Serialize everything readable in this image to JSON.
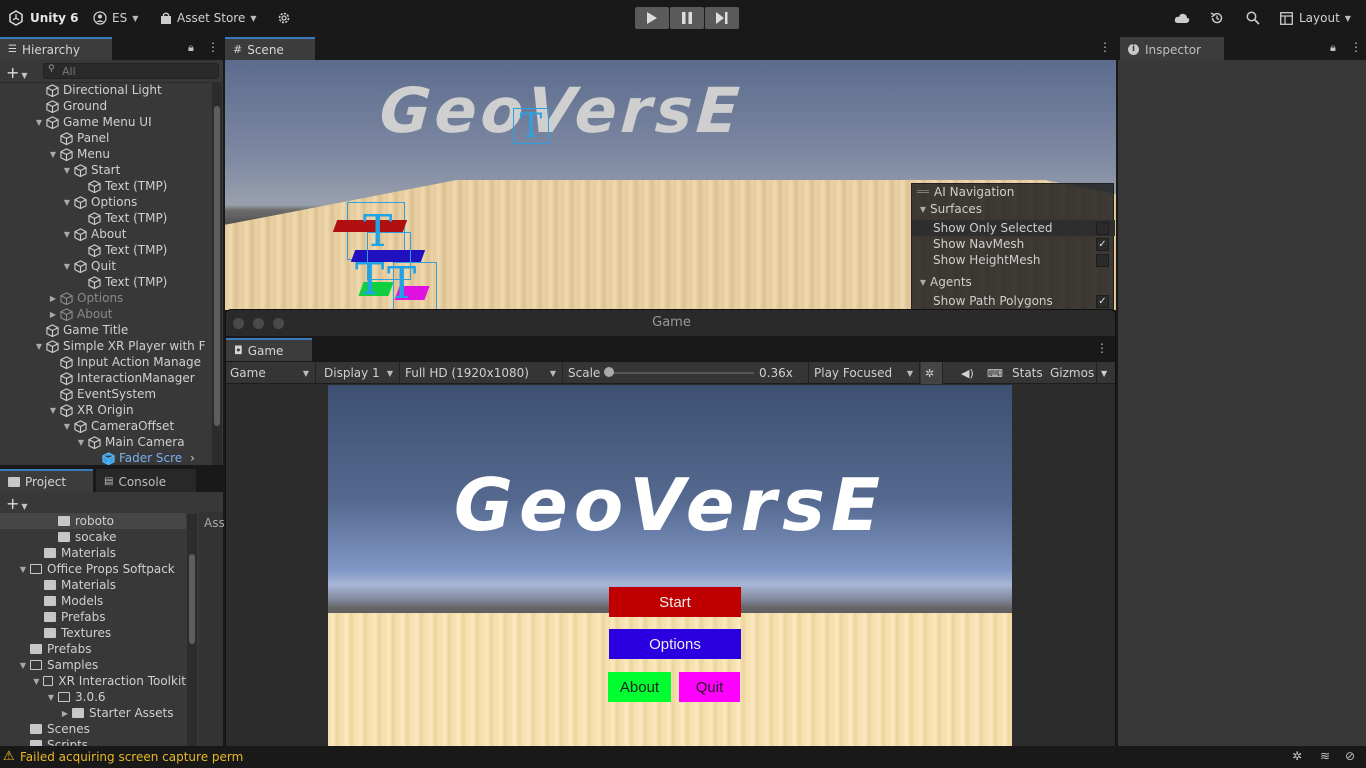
{
  "topbar": {
    "app": "Unity 6",
    "account": "ES",
    "asset_store": "Asset Store",
    "layout": "Layout"
  },
  "hierarchy": {
    "tab": "Hierarchy",
    "search_placeholder": "All",
    "items": [
      {
        "label": "Directional Light",
        "indent": 1,
        "tri": "",
        "dim": false
      },
      {
        "label": "Ground",
        "indent": 1,
        "tri": "",
        "dim": false
      },
      {
        "label": "Game Menu UI",
        "indent": 1,
        "tri": "down",
        "dim": false
      },
      {
        "label": "Panel",
        "indent": 2,
        "tri": "",
        "dim": false
      },
      {
        "label": "Menu",
        "indent": 2,
        "tri": "down",
        "dim": false
      },
      {
        "label": "Start",
        "indent": 3,
        "tri": "down",
        "dim": false
      },
      {
        "label": "Text (TMP)",
        "indent": 4,
        "tri": "",
        "dim": false
      },
      {
        "label": "Options",
        "indent": 3,
        "tri": "down",
        "dim": false
      },
      {
        "label": "Text (TMP)",
        "indent": 4,
        "tri": "",
        "dim": false
      },
      {
        "label": "About",
        "indent": 3,
        "tri": "down",
        "dim": false
      },
      {
        "label": "Text (TMP)",
        "indent": 4,
        "tri": "",
        "dim": false
      },
      {
        "label": "Quit",
        "indent": 3,
        "tri": "down",
        "dim": false
      },
      {
        "label": "Text (TMP)",
        "indent": 4,
        "tri": "",
        "dim": false
      },
      {
        "label": "Options",
        "indent": 2,
        "tri": "right",
        "dim": true
      },
      {
        "label": "About",
        "indent": 2,
        "tri": "right",
        "dim": true
      },
      {
        "label": "Game Title",
        "indent": 1,
        "tri": "",
        "dim": false
      },
      {
        "label": "Simple XR Player with F",
        "indent": 1,
        "tri": "down",
        "dim": false
      },
      {
        "label": "Input Action Manage",
        "indent": 2,
        "tri": "",
        "dim": false
      },
      {
        "label": "InteractionManager",
        "indent": 2,
        "tri": "",
        "dim": false
      },
      {
        "label": "EventSystem",
        "indent": 2,
        "tri": "",
        "dim": false
      },
      {
        "label": "XR Origin",
        "indent": 2,
        "tri": "down",
        "dim": false
      },
      {
        "label": "CameraOffset",
        "indent": 3,
        "tri": "down",
        "dim": false
      },
      {
        "label": "Main Camera",
        "indent": 4,
        "tri": "down",
        "dim": false
      },
      {
        "label": "Fader Scre",
        "indent": 5,
        "tri": "",
        "dim": false,
        "sel": true
      }
    ]
  },
  "project": {
    "tab": "Project",
    "console_tab": "Console",
    "right_label": "Ass",
    "items": [
      {
        "label": "roboto",
        "indent": 3,
        "tri": "",
        "open": false
      },
      {
        "label": "socake",
        "indent": 3,
        "tri": "",
        "open": false
      },
      {
        "label": "Materials",
        "indent": 2,
        "tri": "",
        "open": false
      },
      {
        "label": "Office Props Softpack",
        "indent": 1,
        "tri": "down",
        "open": true
      },
      {
        "label": "Materials",
        "indent": 2,
        "tri": "",
        "open": false
      },
      {
        "label": "Models",
        "indent": 2,
        "tri": "",
        "open": false
      },
      {
        "label": "Prefabs",
        "indent": 2,
        "tri": "",
        "open": false
      },
      {
        "label": "Textures",
        "indent": 2,
        "tri": "",
        "open": false
      },
      {
        "label": "Prefabs",
        "indent": 1,
        "tri": "",
        "open": false
      },
      {
        "label": "Samples",
        "indent": 1,
        "tri": "down",
        "open": true
      },
      {
        "label": "XR Interaction Toolkit",
        "indent": 2,
        "tri": "down",
        "open": true
      },
      {
        "label": "3.0.6",
        "indent": 3,
        "tri": "down",
        "open": true
      },
      {
        "label": "Starter Assets",
        "indent": 4,
        "tri": "right",
        "open": false
      },
      {
        "label": "Scenes",
        "indent": 1,
        "tri": "",
        "open": false
      },
      {
        "label": "Scripts",
        "indent": 1,
        "tri": "",
        "open": false
      }
    ]
  },
  "scene": {
    "tab": "Scene",
    "title_text": "GeoVersE"
  },
  "ai_navigation": {
    "title": "AI Navigation",
    "surfaces": "Surfaces",
    "show_only_selected": "Show Only Selected",
    "show_only_selected_checked": false,
    "show_navmesh": "Show NavMesh",
    "show_navmesh_checked": true,
    "show_heightmesh": "Show HeightMesh",
    "show_heightmesh_checked": false,
    "agents": "Agents",
    "show_path_polygons": "Show Path Polygons",
    "show_path_polygons_checked": true
  },
  "inspector": {
    "tab": "Inspector"
  },
  "game": {
    "window_title": "Game",
    "tab": "Game",
    "toolbar": {
      "view": "Game",
      "display": "Display 1",
      "resolution": "Full HD (1920x1080)",
      "scale_label": "Scale",
      "scale_value": "0.36x",
      "scale_fraction": 0.0,
      "play_mode": "Play Focused",
      "stats": "Stats",
      "gizmos": "Gizmos"
    },
    "title_text": "GeoVersE",
    "buttons": {
      "start": "Start",
      "options": "Options",
      "about": "About",
      "quit": "Quit"
    },
    "colors": {
      "start": "#c00000",
      "options": "#2a00e0",
      "about": "#00ff30",
      "quit": "#ff00ff"
    }
  },
  "status": {
    "message": "Failed acquiring screen capture perm"
  }
}
